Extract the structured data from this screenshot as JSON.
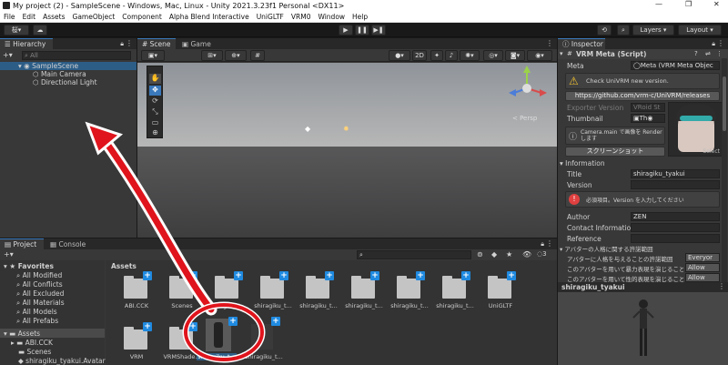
{
  "window": {
    "title": "My project (2) - SampleScene - Windows, Mac, Linux - Unity 2021.3.23f1 Personal <DX11>",
    "minimize": "—",
    "maximize": "❐",
    "close": "✕"
  },
  "menu": [
    "File",
    "Edit",
    "Assets",
    "GameObject",
    "Component",
    "Alpha Blend Interactive",
    "UniGLTF",
    "VRM0",
    "Window",
    "Help"
  ],
  "toolbar": {
    "account": "桜",
    "layers": "Layers",
    "layout": "Layout"
  },
  "hierarchy": {
    "tab": "Hierarchy",
    "search_placeholder": "All",
    "scene": "SampleScene",
    "items": [
      "Main Camera",
      "Directional Light"
    ]
  },
  "scene": {
    "tab_scene": "Scene",
    "tab_game": "Game",
    "mode_2d": "2D",
    "persp": "< Persp"
  },
  "project": {
    "tab_project": "Project",
    "tab_console": "Console",
    "badge": "3",
    "favorites": {
      "title": "Favorites",
      "items": [
        "All Modified",
        "All Conflicts",
        "All Excluded",
        "All Materials",
        "All Models",
        "All Prefabs"
      ]
    },
    "assets_tree": {
      "title": "Assets",
      "items": [
        "ABI.CCK",
        "Scenes",
        "shiragiku_tyakui.Avatar"
      ]
    },
    "breadcrumb": "Assets",
    "folders_row1": [
      "ABI.CCK",
      "Scenes",
      "shiragiku_t...",
      "shiragiku_t...",
      "shiragiku_t...",
      "shiragiku_t...",
      "shiragiku_t...",
      "shiragiku_t...",
      "UniGLTF"
    ],
    "folders_row2": [
      "VRM",
      "VRMShade...",
      "shiragiku_t...",
      "shiragiku_t..."
    ]
  },
  "inspector": {
    "tab": "Inspector",
    "component": "VRM Meta (Script)",
    "meta_label": "Meta",
    "meta_value": "Meta (VRM Meta Objec",
    "warn_text": "Check UniVRM new version.",
    "url_button": "https://github.com/vrm-c/UniVRM/releases",
    "exporter_label": "Exporter Version",
    "exporter_value": "VRoid St",
    "thumbnail_label": "Thumbnail",
    "thumbnail_value": "Th",
    "info_text": "Camera.main で画像を Render します",
    "screenshot_button": "スクリーンショット",
    "select": "Select",
    "information": "Information",
    "title_label": "Title",
    "title_value": "shiragiku_tyakui",
    "version_label": "Version",
    "error_text": "必須項目。Version を入力してください",
    "author_label": "Author",
    "author_value": "ZEN",
    "contact_label": "Contact Information",
    "reference_label": "Reference",
    "permission_header": "アバターの人格に関する許諾範囲",
    "perm_rows": [
      {
        "label": "アバターに人格を与えることの許諾範囲",
        "value": "Everyor"
      },
      {
        "label": "このアバターを用いて暴力表現を演じることの許",
        "value": "Allow"
      },
      {
        "label": "このアバターを用いて性的表現を演じることの許",
        "value": "Allow"
      }
    ],
    "preview_title": "shiragiku_tyakui"
  },
  "colors": {
    "arrow": "#e0141c",
    "accent": "#3a79bb",
    "plus": "#1f8ae0"
  }
}
